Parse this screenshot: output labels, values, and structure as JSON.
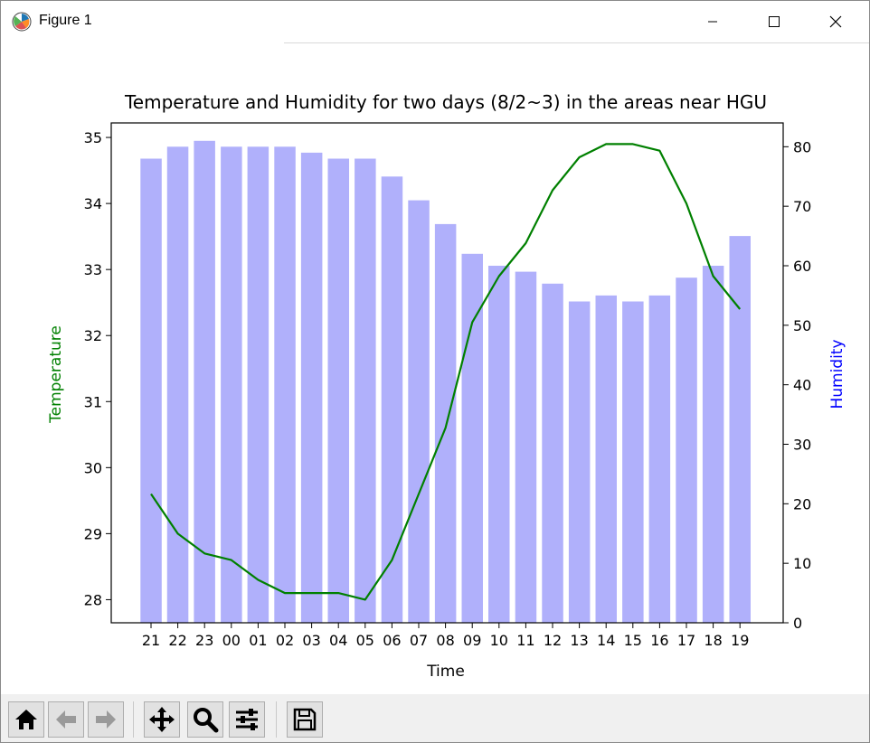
{
  "window": {
    "title": "Figure 1",
    "icons": {
      "app": "matplotlib-icon",
      "minimize": "minimize-icon",
      "maximize": "maximize-icon",
      "close": "close-icon"
    }
  },
  "chart_data": {
    "type": "bar+line",
    "title": "Temperature and Humidity for two days (8/2~3) in the areas near HGU",
    "xlabel": "Time",
    "ylabel_left": "Temperature",
    "ylabel_right": "Humidity",
    "categories": [
      "21",
      "22",
      "23",
      "00",
      "01",
      "02",
      "03",
      "04",
      "05",
      "06",
      "07",
      "08",
      "09",
      "10",
      "11",
      "12",
      "13",
      "14",
      "15",
      "16",
      "17",
      "18",
      "19"
    ],
    "series": [
      {
        "name": "Temperature",
        "type": "line",
        "axis": "left",
        "color": "#008000",
        "values": [
          29.6,
          29.0,
          28.7,
          28.6,
          28.3,
          28.1,
          28.1,
          28.1,
          28.0,
          28.6,
          29.6,
          30.6,
          32.2,
          32.9,
          33.4,
          34.2,
          34.7,
          34.9,
          34.9,
          34.8,
          34.0,
          32.9,
          32.4
        ]
      },
      {
        "name": "Humidity",
        "type": "bar",
        "axis": "right",
        "color": "#b0b0fb",
        "values": [
          78,
          80,
          81,
          80,
          80,
          80,
          79,
          78,
          78,
          75,
          71,
          67,
          62,
          60,
          59,
          57,
          54,
          55,
          54,
          55,
          58,
          60,
          65
        ]
      }
    ],
    "ylim_left": [
      27.65,
      35.22
    ],
    "ylim_right": [
      0,
      84
    ],
    "yticks_left": [
      "28",
      "29",
      "30",
      "31",
      "32",
      "33",
      "34",
      "35"
    ],
    "yticks_right": [
      "0",
      "10",
      "20",
      "30",
      "40",
      "50",
      "60",
      "70",
      "80"
    ],
    "ylabel_left_color": "#008000",
    "ylabel_right_color": "#0000ff",
    "grid": false
  },
  "toolbar": {
    "buttons": [
      {
        "name": "home-button",
        "icon": "home-icon"
      },
      {
        "name": "back-button",
        "icon": "arrow-left-icon"
      },
      {
        "name": "forward-button",
        "icon": "arrow-right-icon"
      },
      {
        "name": "pan-button",
        "icon": "move-icon"
      },
      {
        "name": "zoom-button",
        "icon": "magnifier-icon"
      },
      {
        "name": "configure-subplots-button",
        "icon": "sliders-icon"
      },
      {
        "name": "save-button",
        "icon": "floppy-disk-icon"
      }
    ]
  }
}
